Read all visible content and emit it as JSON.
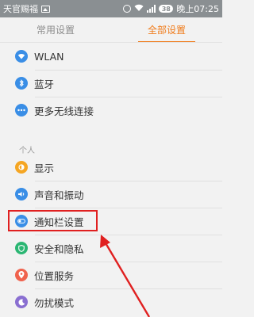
{
  "status_bar": {
    "carrier": "天官赐福",
    "battery": "38",
    "time": "晚上07:25"
  },
  "tabs": [
    {
      "label": "常用设置",
      "active": false
    },
    {
      "label": "全部设置",
      "active": true
    }
  ],
  "wireless": [
    {
      "label": "WLAN",
      "icon": "wifi-icon",
      "color": "#3a8ee6"
    },
    {
      "label": "蓝牙",
      "icon": "bluetooth-icon",
      "color": "#3a8ee6"
    },
    {
      "label": "更多无线连接",
      "icon": "more-icon",
      "color": "#3a8ee6"
    }
  ],
  "personal": {
    "section_title": "个人",
    "items": [
      {
        "label": "显示",
        "icon": "display-icon",
        "color": "#f5a623"
      },
      {
        "label": "声音和振动",
        "icon": "sound-icon",
        "color": "#3a8ee6"
      },
      {
        "label": "通知栏设置",
        "icon": "notification-icon",
        "color": "#3a8ee6",
        "highlighted": true
      },
      {
        "label": "安全和隐私",
        "icon": "shield-icon",
        "color": "#2bb673"
      },
      {
        "label": "位置服务",
        "icon": "location-icon",
        "color": "#f0624d"
      },
      {
        "label": "勿扰模式",
        "icon": "moon-icon",
        "color": "#8a6fd1"
      }
    ]
  },
  "colors": {
    "accent": "#f07b1a",
    "annotation": "#e02020"
  }
}
